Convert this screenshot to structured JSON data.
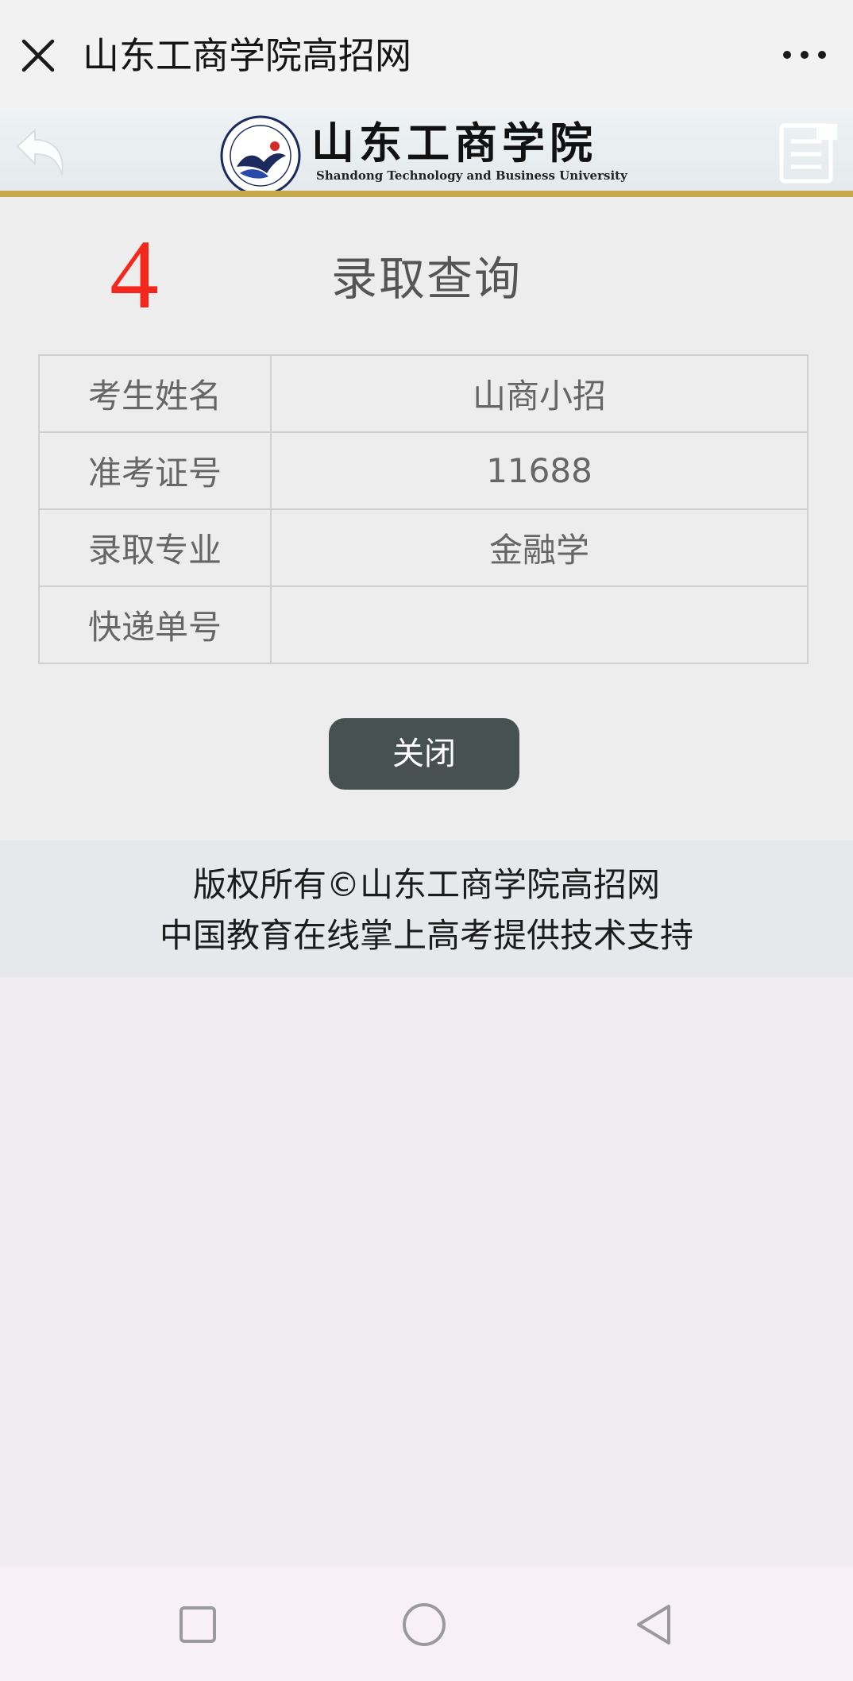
{
  "topbar": {
    "title": "山东工商学院高招网"
  },
  "school_header": {
    "name_cn": "山东工商学院",
    "name_en": "Shandong Technology and Business University",
    "stripe_color": "#c6a94b"
  },
  "annotation": {
    "step_number": "4",
    "color": "#f2281c"
  },
  "page": {
    "title": "录取查询"
  },
  "info_table": {
    "rows": [
      {
        "label": "考生姓名",
        "value": "山商小招"
      },
      {
        "label": "准考证号",
        "value": "11688"
      },
      {
        "label": "录取专业",
        "value": "金融学"
      },
      {
        "label": "快递单号",
        "value": ""
      }
    ]
  },
  "actions": {
    "close_label": "关闭",
    "close_color": "#465150"
  },
  "footer": {
    "line1": "版权所有©山东工商学院高招网",
    "line2": "中国教育在线掌上高考提供技术支持"
  },
  "icons": {
    "topbar_close": "close-icon",
    "topbar_more": "more-dots-icon",
    "header_back": "back-arrow-icon",
    "header_menu": "menu-icon",
    "nav_recent": "recent-apps-icon",
    "nav_home": "home-icon",
    "nav_back": "nav-back-icon"
  }
}
